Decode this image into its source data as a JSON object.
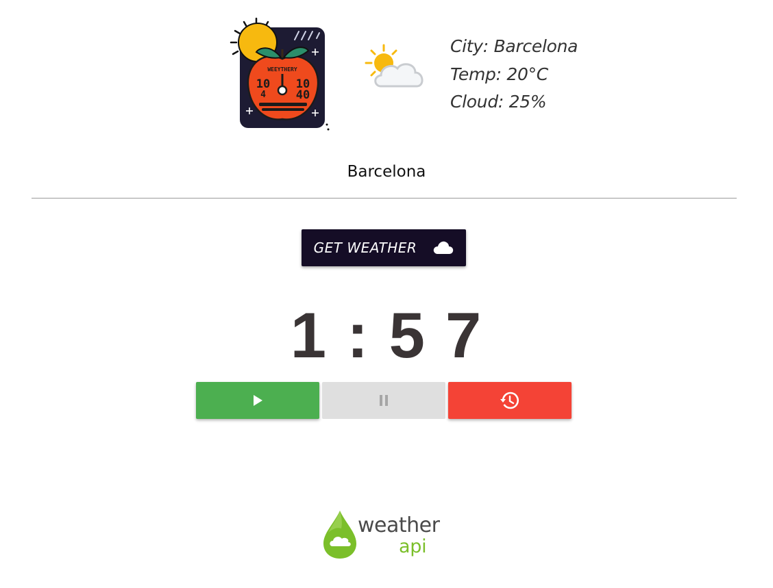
{
  "header": {
    "logo_icon": "apple-timer-logo-icon",
    "logo_text": "WEEYTHERY",
    "logo_clock_left": "10",
    "logo_clock_left_sub": "4",
    "logo_clock_right": "10",
    "logo_clock_right_sub": "40",
    "weather_icon": "partly-cloudy-icon"
  },
  "weather": {
    "city_text": "City: Barcelona",
    "temp_text": "Temp: 20°C",
    "cloud_text": "Cloud: 25%"
  },
  "city_heading": "Barcelona",
  "get_weather_button": {
    "label": "GET WEATHER",
    "icon": "cloud-icon"
  },
  "timer": {
    "display": "1 : 5 7"
  },
  "controls": {
    "play_icon": "play-icon",
    "pause_icon": "pause-icon",
    "reset_icon": "history-icon",
    "play_color": "#4caf50",
    "pause_color": "#dfdfdf",
    "reset_color": "#f44336"
  },
  "footer": {
    "logo_word_1": "weather",
    "logo_word_2": "api",
    "logo_icon": "weatherapi-drop-icon",
    "brand_green": "#7bbf2a"
  }
}
